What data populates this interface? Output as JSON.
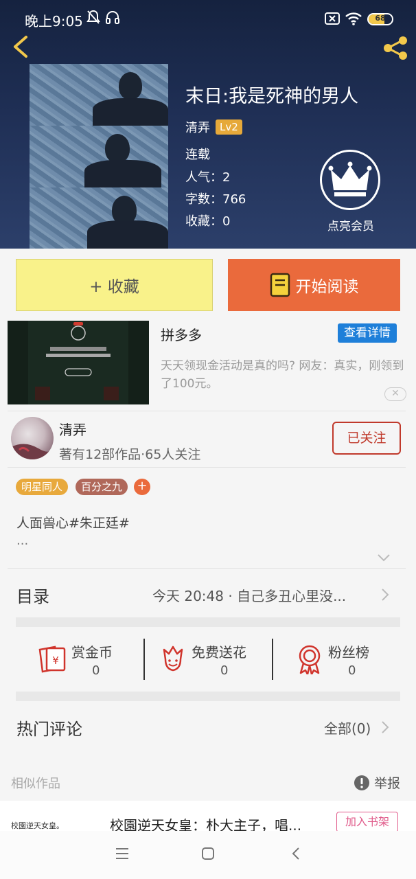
{
  "status_bar": {
    "time": "晚上9:05",
    "battery": "68"
  },
  "book": {
    "title": "末日:我是死神的男人",
    "author": "清弄",
    "author_level": "Lv2",
    "status": "连载",
    "popularity": "人气：2",
    "word_count": "字数：766",
    "favorites": "收藏：0",
    "vip_label": "点亮会员"
  },
  "actions": {
    "collect": "+ 收藏",
    "read": "开始阅读"
  },
  "ad": {
    "brand": "拼多多",
    "detail_button": "查看详情",
    "description": "天天领现金活动是真的吗? 网友：真实，刚领到了100元。"
  },
  "author": {
    "name": "清弄",
    "stats": "著有12部作品·65人关注",
    "follow_button": "已关注"
  },
  "tags": [
    {
      "label": "明星同人",
      "color": "#e8a93c"
    },
    {
      "label": "百分之九",
      "color": "#b0685a"
    }
  ],
  "intro": {
    "text": "人面兽心#朱正廷#",
    "more": "..."
  },
  "catalog": {
    "label": "目录",
    "latest": "今天 20:48 · 自己多丑心里没..."
  },
  "rewards": [
    {
      "label": "赏金币",
      "count": "0",
      "icon": "coin-envelope-icon"
    },
    {
      "label": "免费送花",
      "count": "0",
      "icon": "flower-icon"
    },
    {
      "label": "粉丝榜",
      "count": "0",
      "icon": "rosette-icon"
    }
  ],
  "comments": {
    "label": "热门评论",
    "all": "全部(0)"
  },
  "similar": {
    "label": "相似作品",
    "report": "举报",
    "item_cover_text": "校園逆天女皇。",
    "item_title": "校園逆天女皇：朴大主子，唱...",
    "add_shelf": "加入书架"
  },
  "colors": {
    "accent_orange": "#ea6a3c",
    "collect_yellow": "#f9f28a",
    "follow_red": "#c0392b",
    "hero_navy": "#1f2f55"
  }
}
